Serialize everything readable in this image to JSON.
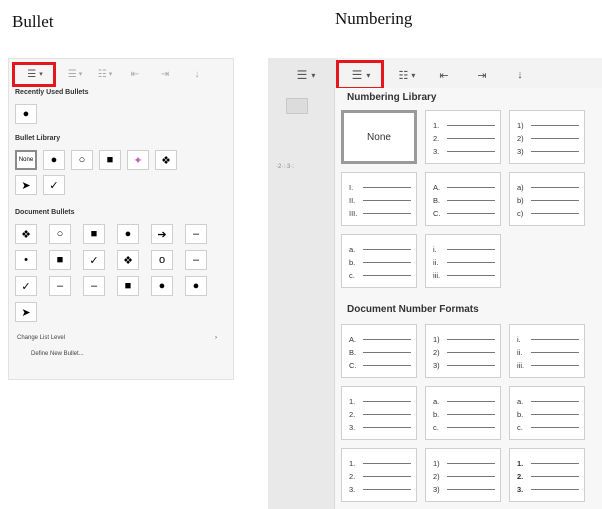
{
  "captions": {
    "left": "Bullet",
    "right": "Numbering"
  },
  "bullet_panel": {
    "recently_used": {
      "title": "Recently Used Bullets",
      "items": [
        "●"
      ]
    },
    "library": {
      "title": "Bullet Library",
      "items": [
        "None",
        "●",
        "○",
        "■",
        "✦",
        "❖",
        "➤",
        "✓"
      ]
    },
    "document": {
      "title": "Document Bullets",
      "rows": [
        [
          "❖",
          "○",
          "■",
          "●",
          "➔",
          "–"
        ],
        [
          "•",
          "■",
          "✓",
          "❖",
          "o",
          "–"
        ],
        [
          "✓",
          "–",
          "–",
          "■",
          "●",
          "●"
        ],
        [
          "➤"
        ]
      ]
    },
    "menu": {
      "change_level": "Change List Level",
      "define_new": "Define New Bullet..."
    }
  },
  "numbering_panel": {
    "library_title": "Numbering Library",
    "none_label": "None",
    "library_cells": [
      [
        "1.",
        "2.",
        "3."
      ],
      [
        "1)",
        "2)",
        "3)"
      ],
      [
        "I.",
        "II.",
        "III."
      ],
      [
        "A.",
        "B.",
        "C."
      ],
      [
        "a)",
        "b)",
        "c)"
      ],
      [
        "a.",
        "b.",
        "c."
      ],
      [
        "i.",
        "ii.",
        "iii."
      ]
    ],
    "doc_title": "Document Number Formats",
    "doc_cells": [
      [
        "A.",
        "B.",
        "C."
      ],
      [
        "1)",
        "2)",
        "3)"
      ],
      [
        "i.",
        "ii.",
        "iii."
      ],
      [
        "1.",
        "2.",
        "3."
      ],
      [
        "a.",
        "b.",
        "c."
      ],
      [
        "a.",
        "b.",
        "c."
      ],
      [
        "1.",
        "2.",
        "3."
      ],
      [
        "1)",
        "2)",
        "3)"
      ],
      [
        "1.",
        "2.",
        "3."
      ]
    ]
  },
  "colors": {
    "highlight": "#e5161c"
  },
  "icons": [
    "bullets-icon",
    "numbering-icon",
    "multilevel-icon",
    "decrease-indent-icon",
    "increase-indent-icon",
    "sort-icon",
    "dropdown-arrow-icon"
  ]
}
